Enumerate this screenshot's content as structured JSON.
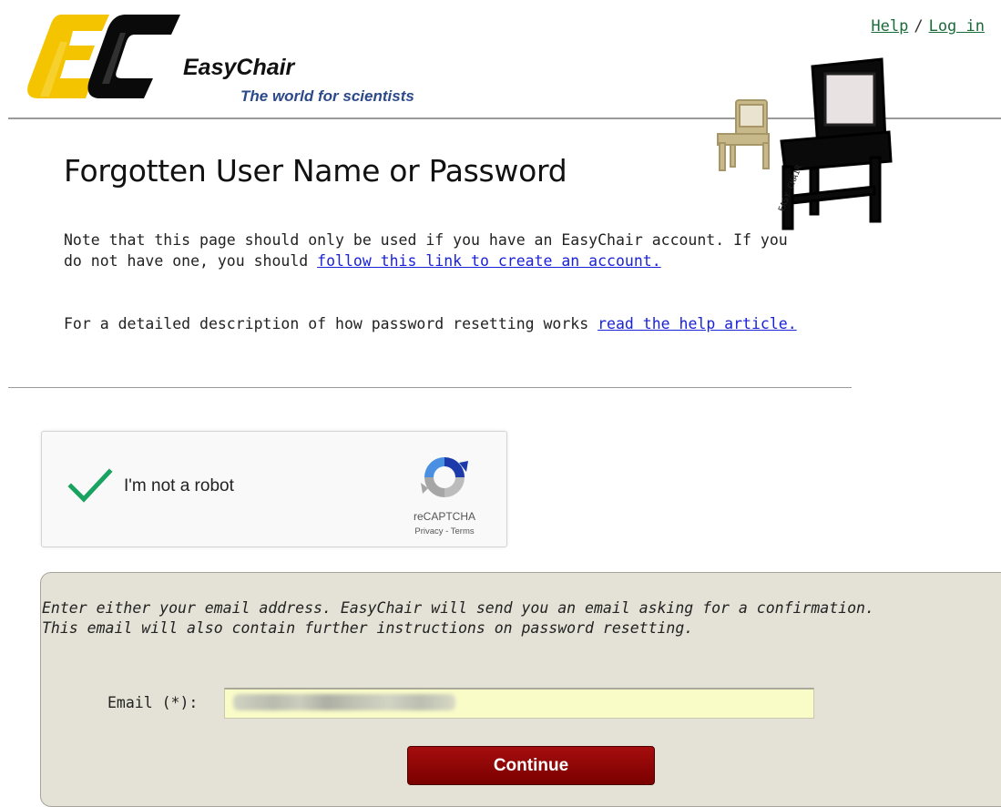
{
  "header": {
    "brand_name": "EasyChair",
    "tagline": "The world for scientists",
    "help_link": "Help",
    "separator": "/",
    "login_link": "Log in"
  },
  "chair_art": {
    "caption": "EASY CHAIR"
  },
  "main": {
    "title": "Forgotten User Name or Password",
    "note1_text": "Note that this page should only be used if you have an EasyChair account. If you do not have one, you should ",
    "note1_link": "follow this link to create an account.",
    "note2_text": "For a detailed description of how password resetting works ",
    "note2_link": "read the help article."
  },
  "captcha": {
    "checked": true,
    "label": "I'm not a robot",
    "brand": "reCAPTCHA",
    "links": "Privacy - Terms"
  },
  "form": {
    "instructions_line1": "Enter either your email address. EasyChair will send you an email asking for a confirmation.",
    "instructions_line2": "This email will also contain further instructions on password resetting.",
    "email_label": "Email (*):",
    "email_value": "",
    "continue_label": "Continue"
  },
  "colors": {
    "logo_yellow": "#f5c400",
    "link_green": "#1a6b3a",
    "link_blue": "#1a22d8",
    "button_red": "#8b0000",
    "panel_bg": "#e4e1d6",
    "input_bg": "#fafcc8",
    "check_green": "#1aa260"
  }
}
